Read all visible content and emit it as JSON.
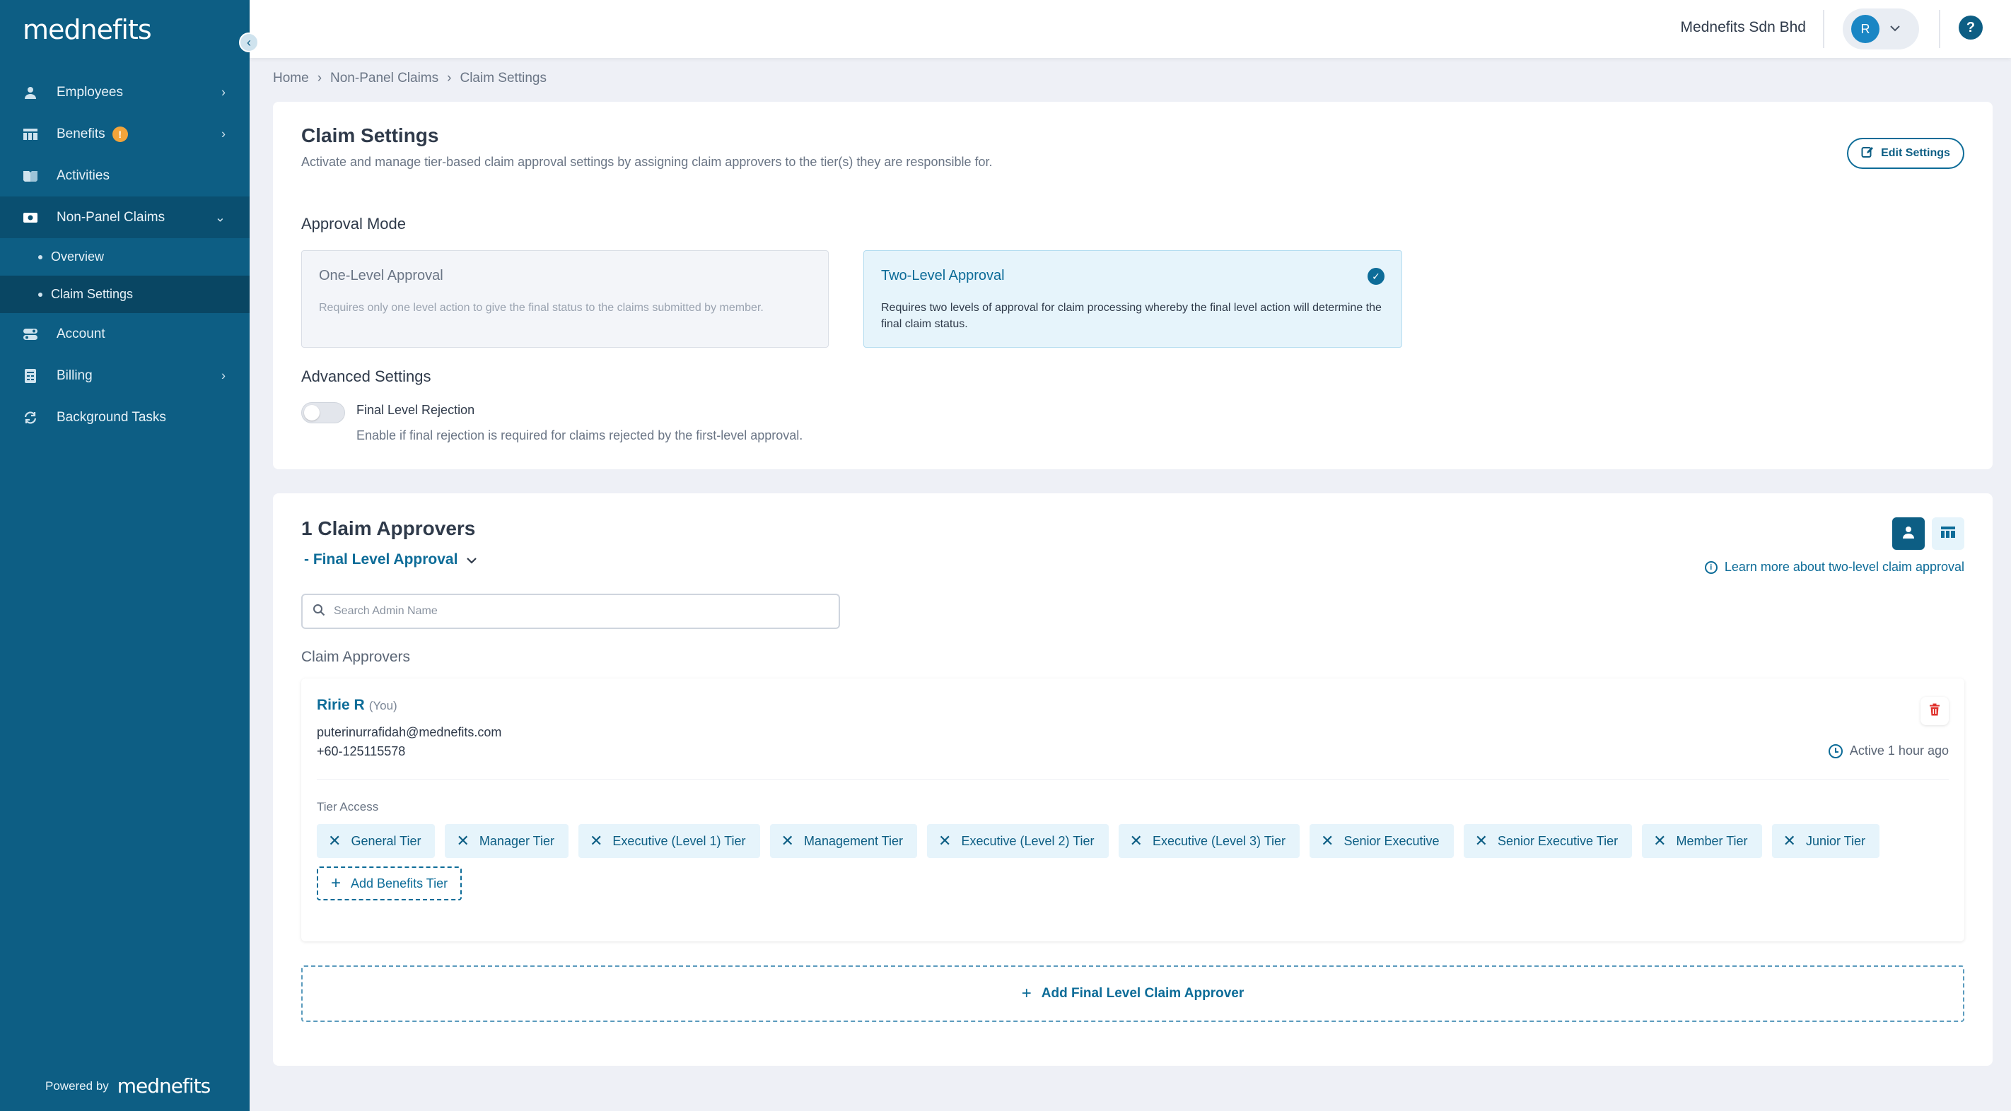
{
  "brand": {
    "logo": "mednefits",
    "powered_by": "Powered by",
    "powered_logo": "mednefits"
  },
  "sidebar": {
    "items": [
      {
        "label": "Employees",
        "icon": "person-icon"
      },
      {
        "label": "Benefits",
        "icon": "table-icon",
        "badge": "!"
      },
      {
        "label": "Activities",
        "icon": "book-icon"
      },
      {
        "label": "Non-Panel Claims",
        "icon": "wallet-icon"
      },
      {
        "label": "Account",
        "icon": "toggle-icon"
      },
      {
        "label": "Billing",
        "icon": "receipt-icon"
      },
      {
        "label": "Background Tasks",
        "icon": "refresh-icon"
      }
    ],
    "sub_items": [
      "Overview",
      "Claim Settings"
    ]
  },
  "header": {
    "company": "Mednefits Sdn Bhd",
    "avatar_initial": "R",
    "help": "?"
  },
  "breadcrumb": [
    "Home",
    "Non-Panel Claims",
    "Claim Settings"
  ],
  "settings": {
    "title": "Claim Settings",
    "subtitle": "Activate and manage tier-based claim approval settings by assigning claim approvers to the tier(s) they are responsible for.",
    "edit_label": "Edit Settings",
    "approval_mode_title": "Approval Mode",
    "modes": [
      {
        "title": "One-Level Approval",
        "desc": "Requires only one level action to give the final status to the claims submitted by member."
      },
      {
        "title": "Two-Level Approval",
        "desc": "Requires two levels of approval for claim processing whereby the final level action will determine the final claim status."
      }
    ],
    "advanced_title": "Advanced Settings",
    "toggle_label": "Final Level Rejection",
    "toggle_desc": "Enable if final rejection is required for claims rejected by the first-level approval."
  },
  "approvers": {
    "title": "1 Claim Approvers",
    "level": "- Final Level Approval",
    "learn_more": "Learn more about two-level claim approval",
    "search_placeholder": "Search Admin Name",
    "section_label": "Claim Approvers",
    "approver": {
      "name": "Ririe R",
      "you": "(You)",
      "email": "puterinurrafidah@mednefits.com",
      "phone": "+60-125115578",
      "active": "Active 1 hour ago",
      "tier_access_label": "Tier Access",
      "tiers": [
        "General Tier",
        "Manager Tier",
        "Executive (Level 1) Tier",
        "Management Tier",
        "Executive (Level 2) Tier",
        "Executive (Level 3) Tier",
        "Senior Executive",
        "Senior Executive Tier",
        "Member Tier",
        "Junior Tier"
      ],
      "add_tier_label": "Add Benefits Tier"
    },
    "add_final_label": "Add Final Level Claim Approver"
  },
  "colors": {
    "sidebar": "#0d5e84",
    "accent": "#0d6c98",
    "chip_bg": "#e6f4fb",
    "warn": "#f2a43a",
    "danger": "#e0332e"
  }
}
